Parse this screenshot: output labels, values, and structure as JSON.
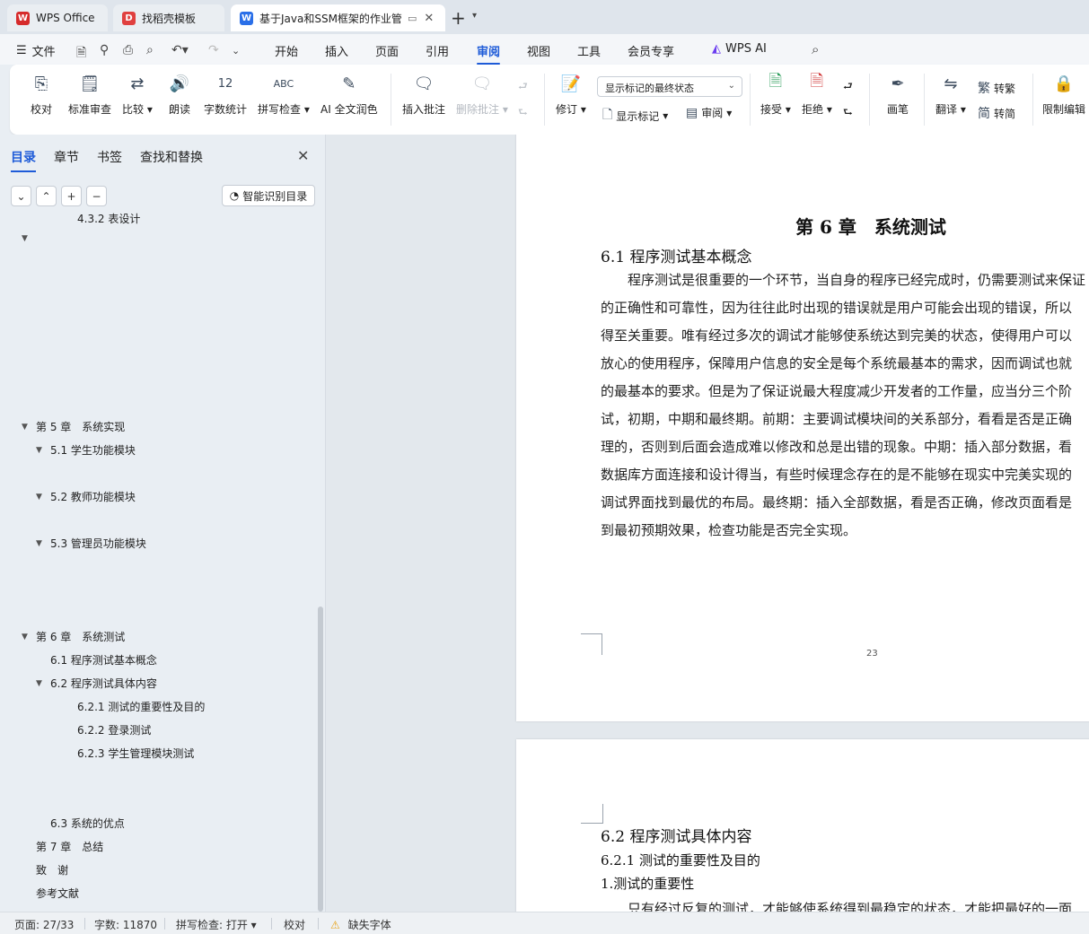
{
  "tabs": [
    {
      "label": "WPS Office",
      "icon": "wps-logo-icon",
      "color": "#d62b2b"
    },
    {
      "label": "找稻壳模板",
      "icon": "docer-logo-icon",
      "color": "#e0403f"
    },
    {
      "label": "基于Java和SSM框架的作业管",
      "icon": "writer-doc-icon",
      "color": "#2a6fe8"
    }
  ],
  "menu": {
    "file_label": "文件",
    "items": [
      "开始",
      "插入",
      "页面",
      "引用",
      "审阅",
      "视图",
      "工具",
      "会员专享"
    ],
    "active": "审阅",
    "ai_label": "WPS AI"
  },
  "ribbon": {
    "proofread": "校对",
    "standard_review": "标准审查",
    "compare": "比较",
    "read_aloud": "朗读",
    "word_count": "字数统计",
    "spell_check": "拼写检查",
    "ai_polish": "AI 全文润色",
    "insert_comment": "插入批注",
    "delete_comment": "删除批注",
    "track_changes": "修订",
    "markup_dropdown": "显示标记的最终状态",
    "show_markup": "显示标记",
    "review_pane": "审阅",
    "accept": "接受",
    "reject": "拒绝",
    "pen": "画笔",
    "translate": "翻译",
    "to_traditional": "转繁",
    "to_simplified": "转简",
    "restrict_editing": "限制编辑"
  },
  "nav": {
    "tabs": [
      "目录",
      "章节",
      "书签",
      "查找和替换"
    ],
    "active_tab": "目录",
    "smart_btn": "智能识别目录",
    "toc": [
      {
        "label": "4.3.2 表设计",
        "level": 3,
        "arrow": ""
      },
      {
        "label": "",
        "level": 1,
        "arrow": "▼"
      },
      {
        "label": "第 5 章　系统实现",
        "level": 1,
        "arrow": "▼"
      },
      {
        "label": "5.1  学生功能模块",
        "level": 2,
        "arrow": "▼"
      },
      {
        "label": "5.2  教师功能模块",
        "level": 2,
        "arrow": "▼"
      },
      {
        "label": "5.3 管理员功能模块",
        "level": 2,
        "arrow": "▼"
      },
      {
        "label": "第 6 章　系统测试",
        "level": 1,
        "arrow": "▼"
      },
      {
        "label": "6.1  程序测试基本概念",
        "level": 2,
        "arrow": ""
      },
      {
        "label": "6.2  程序测试具体内容",
        "level": 2,
        "arrow": "▼"
      },
      {
        "label": "6.2.1  测试的重要性及目的",
        "level": 3,
        "arrow": ""
      },
      {
        "label": "6.2.2 登录测试",
        "level": 3,
        "arrow": ""
      },
      {
        "label": "6.2.3 学生管理模块测试",
        "level": 3,
        "arrow": ""
      },
      {
        "label": "6.3  系统的优点",
        "level": 2,
        "arrow": ""
      },
      {
        "label": "第 7 章　总结",
        "level": 1,
        "arrow": ""
      },
      {
        "label": "致　谢",
        "level": 1,
        "arrow": ""
      },
      {
        "label": "参考文献",
        "level": 1,
        "arrow": ""
      }
    ]
  },
  "document": {
    "chapter_title": "第 6 章　系统测试",
    "section_6_1": "6.1  程序测试基本概念",
    "paragraph_lines": [
      "　　程序测试是很重要的一个环节，当自身的程序已经完成时，仍需要测试来保证",
      "的正确性和可靠性，因为往往此时出现的错误就是用户可能会出现的错误，所以",
      "得至关重要。唯有经过多次的调试才能够使系统达到完美的状态，使得用户可以",
      "放心的使用程序，保障用户信息的安全是每个系统最基本的需求，因而调试也就",
      "的最基本的要求。但是为了保证说最大程度减少开发者的工作量，应当分三个阶",
      "试，初期，中期和最终期。前期：主要调试模块间的关系部分，看看是否是正确",
      "理的，否则到后面会造成难以修改和总是出错的现象。中期：插入部分数据，看",
      "数据库方面连接和设计得当，有些时候理念存在的是不能够在现实中完美实现的",
      "调试界面找到最优的布局。最终期：插入全部数据，看是否正确，修改页面看是",
      "到最初预期效果，检查功能是否完全实现。"
    ],
    "page_number": "23",
    "section_6_2": "6.2  程序测试具体内容",
    "section_6_2_1": "6.2.1  测试的重要性及目的",
    "subheading": "1.测试的重要性",
    "page2_partial_line": "　　只有经过反复的测试，才能够使系统得到最稳定的状态，才能把最好的一面"
  },
  "status": {
    "page": "页面: 27/33",
    "words": "字数: 11870",
    "spell": "拼写检查: 打开",
    "proof": "校对",
    "missing_font": "缺失字体"
  },
  "colors": {
    "accent": "#1e5bd8",
    "warning": "#e8a317"
  }
}
